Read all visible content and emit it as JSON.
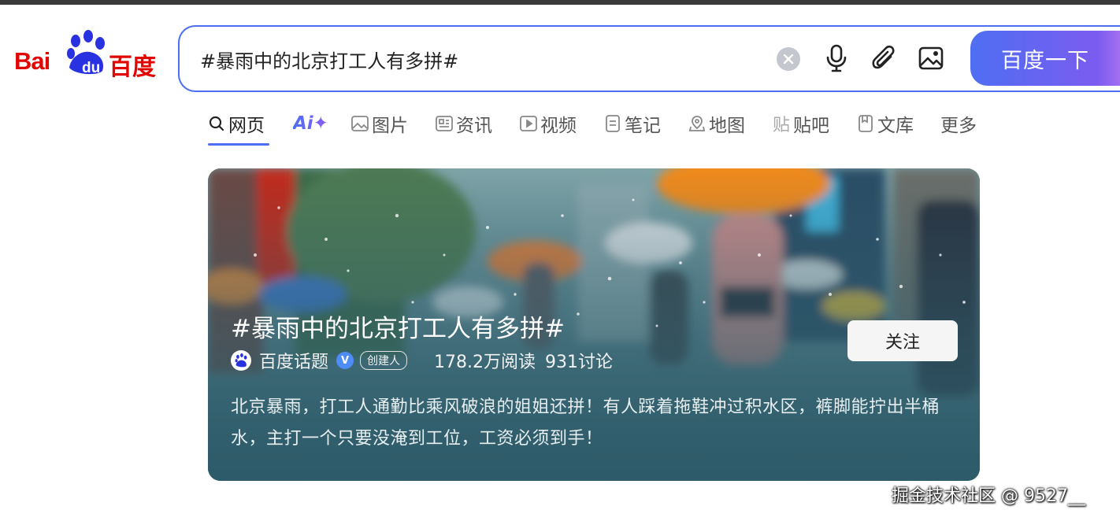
{
  "logo": {
    "bai": "Bai",
    "du": "du",
    "cn": "百度"
  },
  "search": {
    "query": "#暴雨中的北京打工人有多拼#",
    "button_label": "百度一下"
  },
  "tabs": [
    {
      "label": "网页",
      "icon": "search-icon",
      "active": true
    },
    {
      "label": "Ai✦",
      "icon": "ai-sparkle-icon"
    },
    {
      "label": "图片",
      "icon": "image-icon"
    },
    {
      "label": "资讯",
      "icon": "news-icon"
    },
    {
      "label": "视频",
      "icon": "video-icon"
    },
    {
      "label": "笔记",
      "icon": "note-icon"
    },
    {
      "label": "地图",
      "icon": "map-pin-icon"
    },
    {
      "label": "贴吧",
      "icon": "tieba-icon"
    },
    {
      "label": "文库",
      "icon": "document-icon"
    },
    {
      "label": "更多"
    }
  ],
  "card": {
    "title": "#暴雨中的北京打工人有多拼#",
    "source": "百度话题",
    "verified_mark": "V",
    "creator_badge": "创建人",
    "reads": "178.2万阅读",
    "discussions": "931讨论",
    "follow_label": "关注",
    "description": "北京暴雨，打工人通勤比乘风破浪的姐姐还拼！有人踩着拖鞋冲过积水区，裤脚能拧出半桶水，主打一个只要没淹到工位，工资必须到手！"
  },
  "watermark": "掘金技术社区 @ 9527__",
  "colors": {
    "brand_red": "#e10602",
    "accent_blue": "#4e6ef2",
    "purple": "#8b5cf6"
  }
}
